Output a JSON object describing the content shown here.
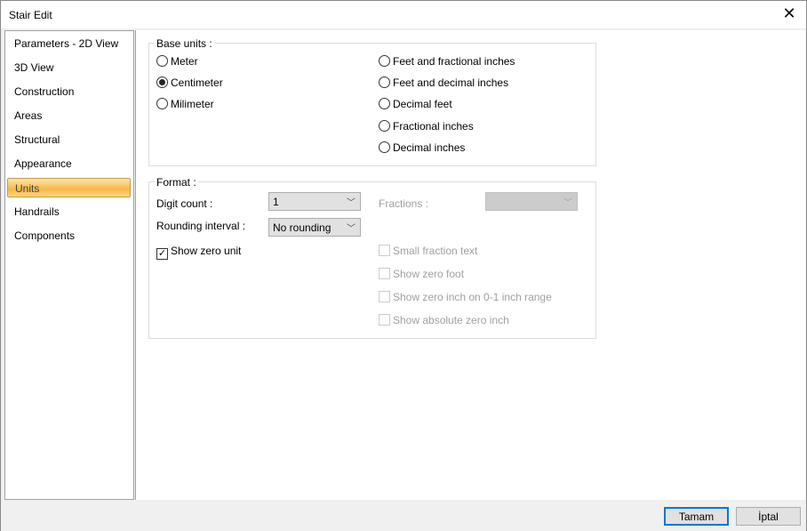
{
  "window": {
    "title": "Stair Edit",
    "close_icon": "close-icon"
  },
  "sidebar": {
    "items": [
      {
        "label": "Parameters - 2D View"
      },
      {
        "label": "3D View"
      },
      {
        "label": "Construction"
      },
      {
        "label": "Areas"
      },
      {
        "label": "Structural"
      },
      {
        "label": "Appearance"
      },
      {
        "label": "Units",
        "active": true
      },
      {
        "label": "Handrails"
      },
      {
        "label": "Components"
      }
    ]
  },
  "base_units": {
    "title": "Base units :",
    "options": [
      {
        "label": "Meter",
        "selected": false
      },
      {
        "label": "Centimeter",
        "selected": true
      },
      {
        "label": "Milimeter",
        "selected": false
      },
      {
        "label": "Feet and fractional inches",
        "selected": false
      },
      {
        "label": "Feet and decimal inches",
        "selected": false
      },
      {
        "label": "Decimal feet",
        "selected": false
      },
      {
        "label": "Fractional inches",
        "selected": false
      },
      {
        "label": "Decimal inches",
        "selected": false
      }
    ]
  },
  "format": {
    "title": "Format :",
    "digit_count_label": "Digit count :",
    "digit_count_value": "1",
    "rounding_label": "Rounding interval :",
    "rounding_value": "No rounding",
    "fractions_label": "Fractions :",
    "fractions_value": "",
    "show_zero_unit": {
      "label": "Show zero unit",
      "checked": true
    },
    "disabled_checks": [
      {
        "label": "Small fraction text",
        "checked": false
      },
      {
        "label": "Show zero foot",
        "checked": false
      },
      {
        "label": "Show zero inch on 0-1 inch range",
        "checked": false
      },
      {
        "label": "Show absolute zero inch",
        "checked": false
      }
    ]
  },
  "footer": {
    "ok_label": "Tamam",
    "cancel_label": "İptal"
  },
  "colors": {
    "active_nav": "#f8b646",
    "default_button_border": "#0078d7"
  }
}
